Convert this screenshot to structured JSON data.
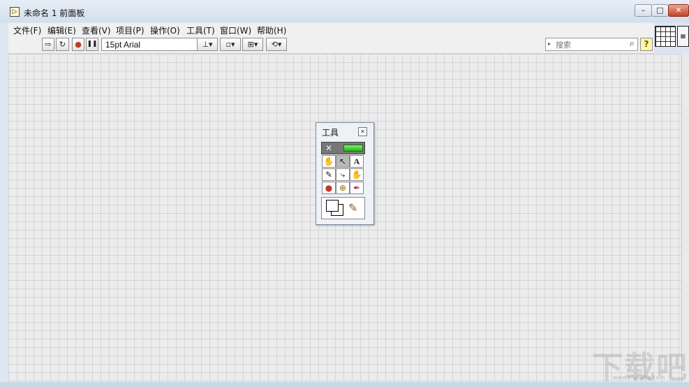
{
  "window": {
    "title": "未命名 1 前面板",
    "app_icon_glyph": "▷",
    "controls": {
      "minimize": "–",
      "maximize": "□",
      "close": "✕"
    }
  },
  "menu": [
    "文件(F)",
    "编辑(E)",
    "查看(V)",
    "项目(P)",
    "操作(O)",
    "工具(T)",
    "窗口(W)",
    "帮助(H)"
  ],
  "toolbar": {
    "run_glyph": "⇨",
    "run_continuous_glyph": "↻",
    "abort_glyph": "●",
    "pause_glyph": "❚❚",
    "font": "15pt Arial",
    "align_glyph": "⊥▾",
    "distribute_glyph": "▫▾",
    "resize_glyph": "⊞▾",
    "reorder_glyph": "⟲▾",
    "search_placeholder": "搜索",
    "help_glyph": "?",
    "icons": {
      "run": "run-arrow-icon",
      "run_continuous": "run-continuously-icon",
      "abort": "abort-icon",
      "pause": "pause-icon",
      "search": "magnifier-icon",
      "help": "context-help-icon"
    }
  },
  "tools_palette": {
    "title": "工具",
    "close_glyph": "✕",
    "auto_select_glyph": "✕",
    "rows": [
      [
        "✋",
        "↖",
        "A"
      ],
      [
        "✎",
        "⤷",
        "✋"
      ],
      [
        "●",
        "⊕",
        "✒"
      ]
    ],
    "selected_tool": "positioning-tool",
    "brush_glyph": "✎"
  },
  "watermark": {
    "text": "下载吧",
    "sub": "www.xiazaiba.com"
  },
  "colors": {
    "auto_led": "#25b51a",
    "titlebar": "#d3dfec",
    "canvas": "#ececec"
  }
}
